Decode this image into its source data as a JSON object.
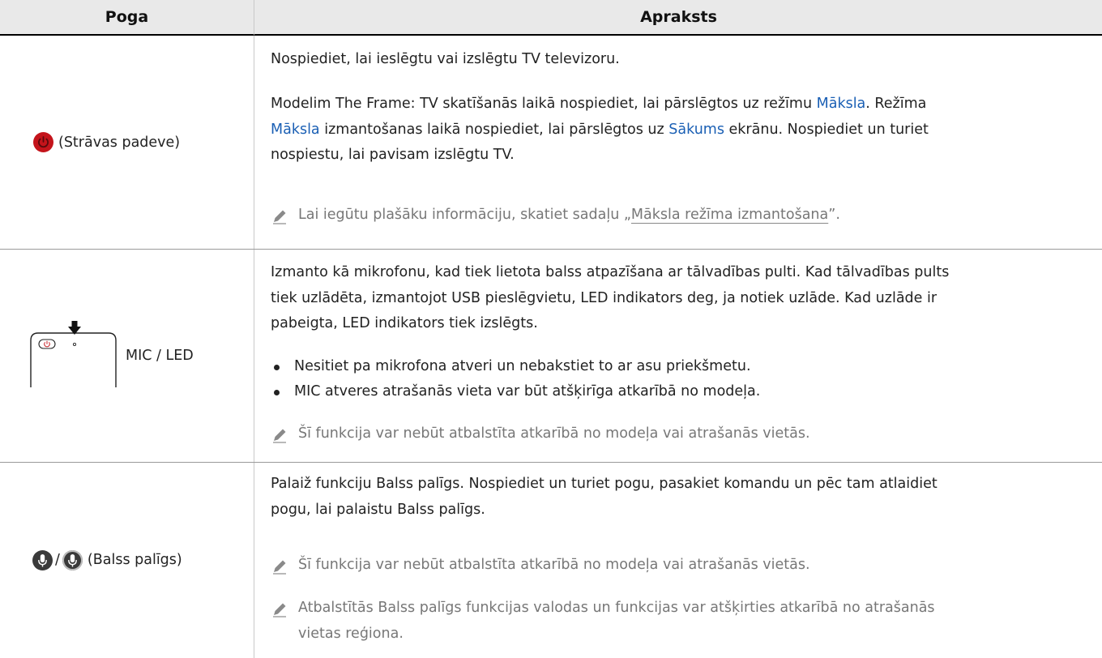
{
  "header": {
    "col1": "Poga",
    "col2": "Apraksts"
  },
  "rows": [
    {
      "key_label": "(Strāvas padeve)",
      "paragraphs": [
        "Nospiediet, lai ieslēgtu vai izslēgtu TV televizoru.",
        {
          "p1": "Modelim The Frame: TV skatīšanās laikā nospiediet, lai pārslēgtos uz režīmu ",
          "link1": "Māksla",
          "p2": ". Režīma",
          "link2": "Māksla",
          "p3": " izmantošanas laikā nospiediet, lai pārslēgtos uz ",
          "link3": "Sākums",
          "p4": " ekrānu. Nospiediet un turiet",
          "p5": "nospiestu, lai pavisam izslēgtu TV."
        }
      ],
      "note_prefix": "Lai iegūtu plašāku informāciju, skatiet sadaļu „",
      "note_link": "Māksla režīma izmantošana",
      "note_suffix": "”."
    },
    {
      "key_label": "MIC / LED",
      "paragraph_lines": [
        "Izmanto kā mikrofonu, kad tiek lietota balss atpazīšana ar tālvadības pulti. Kad tālvadības pults",
        "tiek uzlādēta, izmantojot USB pieslēgvietu, LED indikators deg, ja notiek uzlāde. Kad uzlāde ir",
        "pabeigta, LED indikators tiek izslēgts."
      ],
      "bullets": [
        "Nesitiet pa mikrofona atveri un nebakstiet to ar asu priekšmetu.",
        "MIC atveres atrašanās vieta var būt atšķirīga atkarībā no modeļa."
      ],
      "note": "Šī funkcija var nebūt atbalstīta atkarībā no modeļa vai atrašanās vietās."
    },
    {
      "key_separator": "/",
      "key_label": "(Balss palīgs)",
      "paragraph_lines": [
        "Palaiž funkciju Balss palīgs. Nospiediet un turiet pogu, pasakiet komandu un pēc tam atlaidiet",
        "pogu, lai palaistu Balss palīgs."
      ],
      "note1": "Šī funkcija var nebūt atbalstīta atkarībā no modeļa vai atrašanās vietās.",
      "note2_lines": [
        "Atbalstītās Balss palīgs funkcijas valodas un funkcijas var atšķirties atkarībā no atrašanās",
        "vietas reģiona."
      ]
    }
  ],
  "icons": {
    "power": "power-button-icon",
    "mic_dark": "mic-button-dark-icon",
    "mic_light": "mic-button-light-icon",
    "remote": "remote-mic-location-icon",
    "note": "pencil-note-icon"
  },
  "colors": {
    "link": "#1a5fb4",
    "header_bg": "#e9e9e9",
    "power_red": "#c4141b",
    "note_gray": "#777777"
  }
}
